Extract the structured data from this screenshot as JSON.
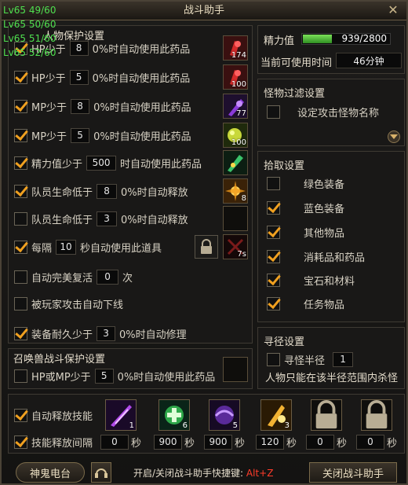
{
  "window": {
    "title": "战斗助手",
    "close_icon": "close-icon"
  },
  "level_log": [
    "Lv65 49/60",
    "Lv65 50/60",
    "Lv65 51/60",
    "Lv65 52/60"
  ],
  "protect": {
    "title": "人物保护设置",
    "rows": [
      {
        "checked": true,
        "label": "HP少于",
        "value": "8",
        "suffix": "0%时自动使用此药品",
        "item_count": "174",
        "icon": "red-potion-icon"
      },
      {
        "checked": true,
        "label": "HP少于",
        "value": "5",
        "suffix": "0%时自动使用此药品",
        "item_count": "100",
        "icon": "red-potion-icon"
      },
      {
        "checked": true,
        "label": "MP少于",
        "value": "8",
        "suffix": "0%时自动使用此药品",
        "item_count": "77",
        "icon": "purple-potion-icon"
      },
      {
        "checked": true,
        "label": "MP少于",
        "value": "5",
        "suffix": "0%时自动使用此药品",
        "item_count": "100",
        "icon": "yellow-potion-icon"
      },
      {
        "checked": true,
        "label": "精力值少于",
        "value": "500",
        "suffix": "时自动使用此药品",
        "item_count": "",
        "icon": "green-potion-icon"
      },
      {
        "checked": true,
        "label": "队员生命低于",
        "value": "8",
        "suffix": "0%时自动释放",
        "item_count": "8",
        "icon": "sunburst-skill-icon"
      },
      {
        "checked": false,
        "label": "队员生命低于",
        "value": "3",
        "suffix": "0%时自动释放",
        "item_count": "",
        "icon": "empty-slot"
      },
      {
        "checked": true,
        "label": "每隔",
        "value": "10",
        "suffix": "秒自动使用此道具",
        "item_count": "7s",
        "icon": "dark-item-icon"
      }
    ],
    "revive": {
      "checked": false,
      "label": "自动完美复活",
      "value": "0",
      "suffix": "次"
    },
    "logout": {
      "checked": false,
      "label": "被玩家攻击自动下线"
    },
    "repair": {
      "checked": true,
      "label": "装备耐久少于",
      "value": "3",
      "suffix": "0%时自动修理"
    }
  },
  "pet": {
    "title": "召唤兽战斗保护设置",
    "row": {
      "checked": false,
      "label": "HP或MP少于",
      "value": "5",
      "suffix": "0%时自动使用此药品"
    }
  },
  "energy": {
    "label": "精力值",
    "value_text": "939/2800",
    "fill_fraction": 0.335,
    "time_label": "当前可使用时间",
    "time_value": "46分钟"
  },
  "monster_filter": {
    "title": "怪物过滤设置",
    "label": "设定攻击怪物名称",
    "checked": false
  },
  "pickup": {
    "title": "拾取设置",
    "items": [
      {
        "checked": false,
        "label": "绿色装备"
      },
      {
        "checked": true,
        "label": "蓝色装备"
      },
      {
        "checked": true,
        "label": "其他物品"
      },
      {
        "checked": true,
        "label": "消耗品和药品"
      },
      {
        "checked": true,
        "label": "宝石和材料"
      },
      {
        "checked": true,
        "label": "任务物品"
      }
    ]
  },
  "path": {
    "title": "寻径设置",
    "label": "寻怪半径",
    "value": "1",
    "note": "人物只能在该半径范围内杀怪",
    "checked": false
  },
  "skills": {
    "auto_label": "自动释放技能",
    "auto_checked": true,
    "interval_label": "技能释放间隔",
    "interval_checked": true,
    "unit": "秒",
    "slots": [
      {
        "icon": "purple-slash-skill-icon",
        "count": "1",
        "interval": "0",
        "locked": false
      },
      {
        "icon": "green-heal-skill-icon",
        "count": "6",
        "interval": "900",
        "locked": false
      },
      {
        "icon": "purple-orb-skill-icon",
        "count": "5",
        "interval": "900",
        "locked": false
      },
      {
        "icon": "golden-strike-skill-icon",
        "count": "3",
        "interval": "120",
        "locked": false
      },
      {
        "icon": "lock-icon",
        "count": "",
        "interval": "0",
        "locked": true
      },
      {
        "icon": "lock-icon",
        "count": "",
        "interval": "0",
        "locked": true
      }
    ]
  },
  "footer": {
    "radio": "神鬼电台",
    "hotkey_text": "开启/关闭战斗助手快捷键:",
    "hotkey": "Alt+Z",
    "close_button": "关闭战斗助手"
  },
  "colors": {
    "accent": "#f0a020",
    "energy_bar": "#4fc23a",
    "hotkey": "#ff3c2a",
    "level_log": "#4fe04f"
  }
}
